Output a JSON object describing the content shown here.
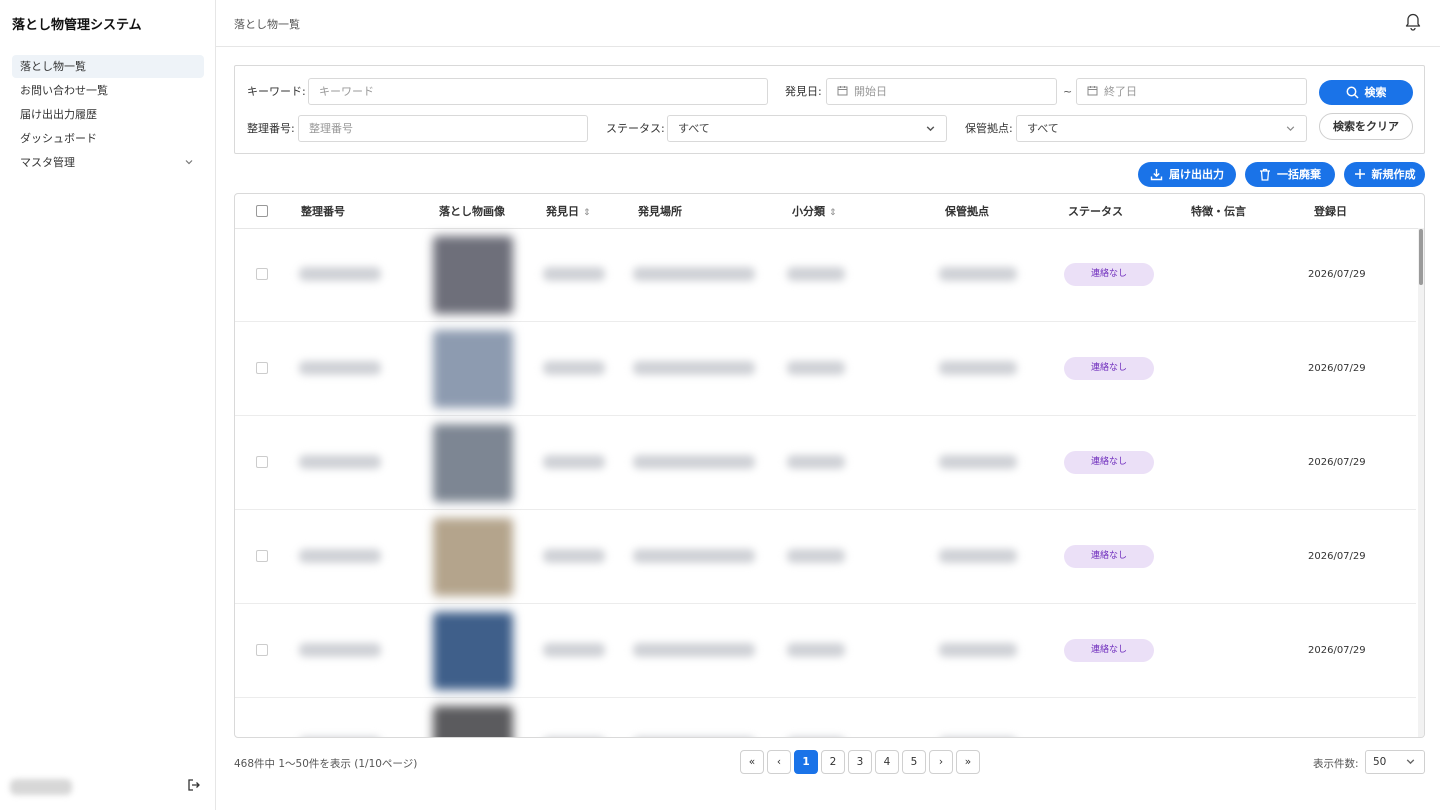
{
  "app": {
    "title": "落とし物管理システム"
  },
  "sidebar": {
    "items": [
      {
        "label": "落とし物一覧",
        "active": true
      },
      {
        "label": "お問い合わせ一覧"
      },
      {
        "label": "届け出出力履歴"
      },
      {
        "label": "ダッシュボード"
      },
      {
        "label": "マスタ管理",
        "expandable": true
      }
    ]
  },
  "header": {
    "breadcrumb": "落とし物一覧"
  },
  "search": {
    "keyword_label": "キーワード:",
    "keyword_placeholder": "キーワード",
    "found_date_label": "発見日:",
    "start_placeholder": "開始日",
    "range_separator": "~",
    "end_placeholder": "終了日",
    "search_button": "検索",
    "number_label": "整理番号:",
    "number_placeholder": "整理番号",
    "status_label": "ステータス:",
    "status_value": "すべて",
    "location_label": "保管拠点:",
    "location_value": "すべて",
    "clear_button": "検索をクリア"
  },
  "actions": {
    "export": "届け出出力",
    "bulk_discard": "一括廃棄",
    "create": "新規作成"
  },
  "table": {
    "headers": {
      "number": "整理番号",
      "image": "落とし物画像",
      "found_date": "発見日",
      "found_place": "発見場所",
      "subcategory": "小分類",
      "storage": "保管拠点",
      "status": "ステータス",
      "features": "特徴・伝言",
      "registered": "登録日"
    },
    "rows": [
      {
        "status": "連絡なし",
        "registered": "2026/07/29",
        "thumb_color": "#6e6f7a"
      },
      {
        "status": "連絡なし",
        "registered": "2026/07/29",
        "thumb_color": "#8d9bb0"
      },
      {
        "status": "連絡なし",
        "registered": "2026/07/29",
        "thumb_color": "#7d8693"
      },
      {
        "status": "連絡なし",
        "registered": "2026/07/29",
        "thumb_color": "#b4a48c"
      },
      {
        "status": "連絡なし",
        "registered": "2026/07/29",
        "thumb_color": "#3f5f8a"
      },
      {
        "status": "",
        "registered": "",
        "thumb_color": "#5b5b5e"
      }
    ]
  },
  "footer": {
    "count_text": "468件中 1〜50件を表示 (1/10ページ)",
    "pages": [
      "1",
      "2",
      "3",
      "4",
      "5"
    ],
    "current_page": "1",
    "per_page_label": "表示件数:",
    "per_page_value": "50"
  },
  "colors": {
    "primary": "#1a73e8",
    "badge_bg": "#ebe0f7",
    "badge_text": "#6f2dbd"
  }
}
